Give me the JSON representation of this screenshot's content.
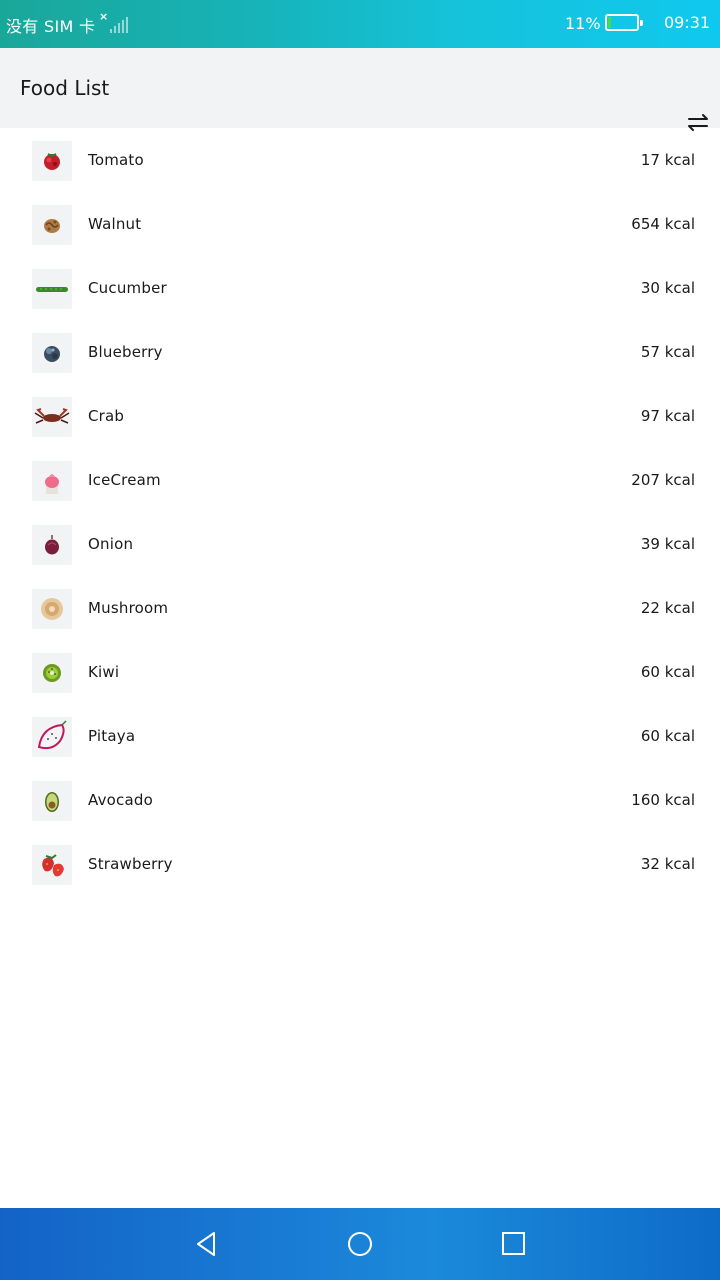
{
  "status_bar": {
    "carrier": "没有 SIM 卡",
    "battery_percent": "11%",
    "battery_level": 0.11,
    "time": "09:31"
  },
  "header": {
    "title": "Food List",
    "sort_icon": "swap-sort-icon"
  },
  "foods": [
    {
      "name": "Tomato",
      "kcal": "17 kcal",
      "icon": "tomato-icon"
    },
    {
      "name": "Walnut",
      "kcal": "654 kcal",
      "icon": "walnut-icon"
    },
    {
      "name": "Cucumber",
      "kcal": "30 kcal",
      "icon": "cucumber-icon"
    },
    {
      "name": "Blueberry",
      "kcal": "57 kcal",
      "icon": "blueberry-icon"
    },
    {
      "name": "Crab",
      "kcal": "97 kcal",
      "icon": "crab-icon"
    },
    {
      "name": "IceCream",
      "kcal": "207 kcal",
      "icon": "icecream-icon"
    },
    {
      "name": "Onion",
      "kcal": "39 kcal",
      "icon": "onion-icon"
    },
    {
      "name": "Mushroom",
      "kcal": "22 kcal",
      "icon": "mushroom-icon"
    },
    {
      "name": "Kiwi",
      "kcal": "60 kcal",
      "icon": "kiwi-icon"
    },
    {
      "name": "Pitaya",
      "kcal": "60 kcal",
      "icon": "pitaya-icon"
    },
    {
      "name": "Avocado",
      "kcal": "160 kcal",
      "icon": "avocado-icon"
    },
    {
      "name": "Strawberry",
      "kcal": "32 kcal",
      "icon": "strawberry-icon"
    }
  ],
  "nav_bar": {
    "back_icon": "back-triangle-icon",
    "home_icon": "home-circle-icon",
    "recents_icon": "recents-square-icon"
  }
}
